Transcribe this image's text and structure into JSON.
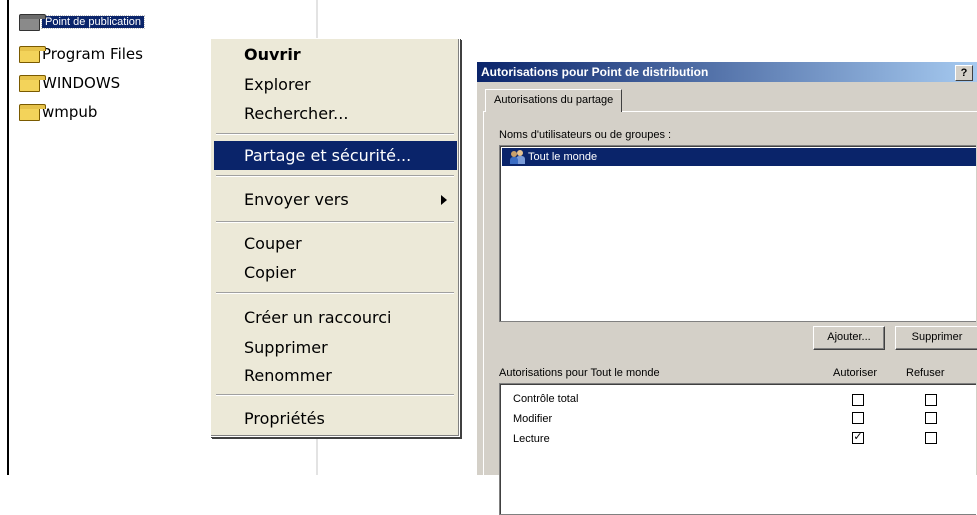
{
  "explorer": {
    "items": [
      {
        "label": "Point de publication",
        "selected": true
      },
      {
        "label": "Program Files",
        "selected": false
      },
      {
        "label": "WINDOWS",
        "selected": false
      },
      {
        "label": "wmpub",
        "selected": false
      }
    ]
  },
  "context_menu": {
    "open": "Ouvrir",
    "explore": "Explorer",
    "search": "Rechercher...",
    "share": "Partage et sécurité...",
    "send_to": "Envoyer vers",
    "cut": "Couper",
    "copy": "Copier",
    "shortcut": "Créer un raccourci",
    "delete": "Supprimer",
    "rename": "Renommer",
    "properties": "Propriétés"
  },
  "dialog": {
    "title": "Autorisations pour Point de distribution",
    "help": "?",
    "tab": "Autorisations du partage",
    "users_label": "Noms d'utilisateurs ou de groupes :",
    "users": [
      "Tout le monde"
    ],
    "add_button": "Ajouter...",
    "remove_button": "Supprimer",
    "perms_label": "Autorisations pour Tout le monde",
    "allow_header": "Autoriser",
    "deny_header": "Refuser",
    "permissions": [
      {
        "name": "Contrôle total",
        "allow": false,
        "deny": false
      },
      {
        "name": "Modifier",
        "allow": false,
        "deny": false
      },
      {
        "name": "Lecture",
        "allow": true,
        "deny": false
      }
    ]
  },
  "colors": {
    "selection": "#0a246a",
    "menu_bg": "#ece9d8",
    "dialog_bg": "#d4d0c8"
  }
}
